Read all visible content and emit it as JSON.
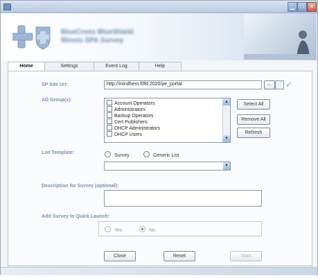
{
  "window": {
    "title": "Survey Automation Tool"
  },
  "banner": {
    "org_line1": "BlueCross BlueShield",
    "org_line2": "Illinois SPA Survey"
  },
  "tabs": [
    "Home",
    "Settings",
    "Event Log",
    "Help"
  ],
  "sp_site": {
    "label": "SP Site Url:",
    "value": "http://mindhem.f0fd 2020/pe_portal",
    "browse_label": "..."
  },
  "ad_groups": {
    "label": "AD Group(s):",
    "items": [
      "Account Operators",
      "Administrators",
      "Backup Operators",
      "Cert Publishers",
      "DHCP Administrators",
      "DHCP Users"
    ],
    "select_all": "Select All",
    "remove_all": "Remove All",
    "refresh": "Refresh"
  },
  "list_template": {
    "label": "List Template:",
    "option1": "Survey",
    "option2": "Generic List",
    "selected_value": ""
  },
  "description": {
    "label": "Description for Survey (optional):",
    "value": ""
  },
  "quick_launch": {
    "label": "Add Survey to Quick Launch:",
    "yes": "Yes",
    "no": "No"
  },
  "actions": {
    "close": "Close",
    "reset": "Reset",
    "start": "Start"
  },
  "colors": {
    "accent": "#7a8fb2",
    "brand": "#6b86ab"
  },
  "icons": {
    "checkmark": "check-icon",
    "dropdown": "chevron-down-icon"
  }
}
